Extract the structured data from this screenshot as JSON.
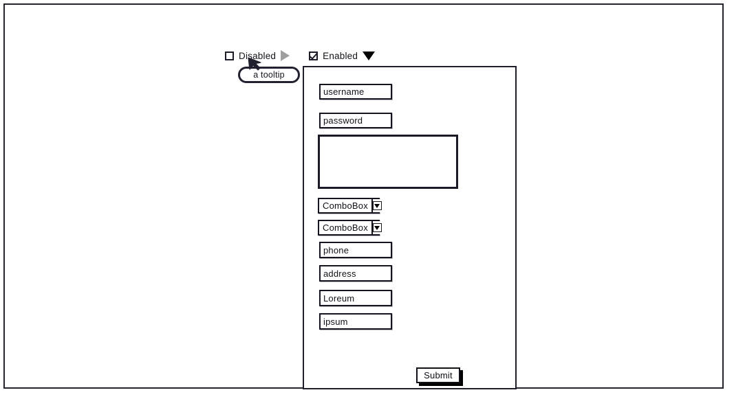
{
  "window": {
    "frame_color": "#23232e",
    "background": "#ffffff"
  },
  "checkbox_row": {
    "items": [
      {
        "label": "Disabled",
        "checked": false,
        "indicator_icon": "triangle-right-icon",
        "indicator_color": "#9a9a9a",
        "state": "disabled"
      },
      {
        "label": "Enabled",
        "checked": true,
        "indicator_icon": "triangle-down-icon",
        "indicator_color": "#000000",
        "state": "enabled"
      }
    ]
  },
  "tooltip": {
    "text": "a tooltip",
    "cursor_icon": "mouse-pointer-icon",
    "border_color": "#20202e"
  },
  "form": {
    "border_color": "#1e1e2a",
    "fields": [
      {
        "name": "username",
        "value": "username",
        "type": "text"
      },
      {
        "name": "password",
        "value": "password",
        "type": "text"
      },
      {
        "name": "notes",
        "value": "",
        "type": "textarea"
      },
      {
        "name": "combo_1",
        "value": "ComboBox",
        "type": "combobox"
      },
      {
        "name": "combo_2",
        "value": "ComboBox",
        "type": "combobox"
      },
      {
        "name": "phone",
        "value": "phone",
        "type": "text"
      },
      {
        "name": "address",
        "value": "address",
        "type": "text"
      },
      {
        "name": "loreum",
        "value": "Loreum",
        "type": "text"
      },
      {
        "name": "ipsum",
        "value": "ipsum",
        "type": "text"
      }
    ],
    "submit": {
      "label": "Submit",
      "shadow_color": "#000000"
    }
  }
}
